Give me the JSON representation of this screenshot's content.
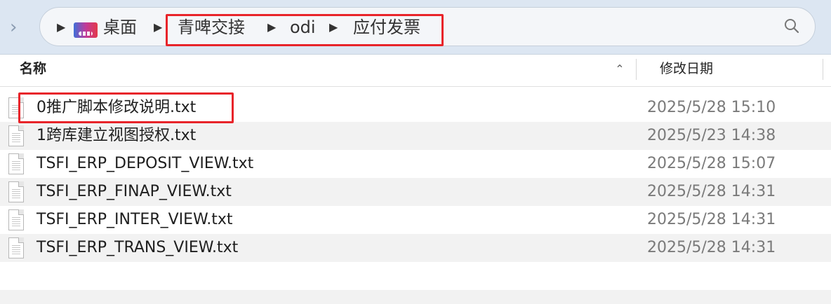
{
  "pathbar": {
    "crumbs": [
      {
        "label": "桌面",
        "icon": "colorful-folder-icon"
      },
      {
        "label": "青啤交接"
      },
      {
        "label": "odi"
      },
      {
        "label": "应付发票"
      }
    ],
    "separator": "▶",
    "back": "›",
    "highlight_color": "#e8242a"
  },
  "columns": {
    "name": "名称",
    "date": "修改日期",
    "sort_glyph": "⌃"
  },
  "files": [
    {
      "name": "0推广脚本修改说明.txt",
      "date": "2025/5/28 15:10",
      "icon": "text-file-icon"
    },
    {
      "name": "1跨库建立视图授权.txt",
      "date": "2025/5/23 14:38",
      "icon": "text-file-icon"
    },
    {
      "name": "TSFI_ERP_DEPOSIT_VIEW.txt",
      "date": "2025/5/28 15:07",
      "icon": "text-file-icon"
    },
    {
      "name": "TSFI_ERP_FINAP_VIEW.txt",
      "date": "2025/5/28 14:31",
      "icon": "text-file-icon"
    },
    {
      "name": "TSFI_ERP_INTER_VIEW.txt",
      "date": "2025/5/28 14:31",
      "icon": "text-file-icon"
    },
    {
      "name": "TSFI_ERP_TRANS_VIEW.txt",
      "date": "2025/5/28 14:31",
      "icon": "text-file-icon"
    }
  ]
}
